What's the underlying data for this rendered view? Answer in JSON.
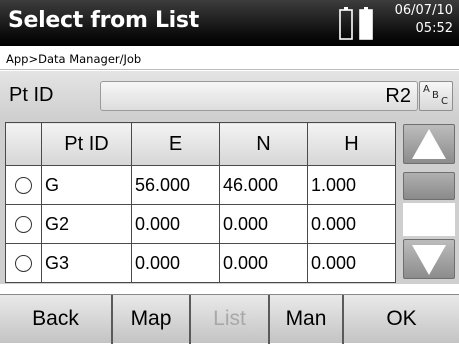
{
  "header": {
    "title": "Select from List",
    "date": "06/07/10",
    "time": "05:52"
  },
  "breadcrumb": "App>Data Manager/Job",
  "point_id": {
    "label": "Pt ID",
    "value": "R2",
    "input_mode_button": {
      "a": "A",
      "b": "B",
      "c": "C"
    }
  },
  "table": {
    "columns": [
      "Pt ID",
      "E",
      "N",
      "H"
    ],
    "rows": [
      {
        "id": "G",
        "e": "56.000",
        "n": "46.000",
        "h": "1.000"
      },
      {
        "id": "G2",
        "e": "0.000",
        "n": "0.000",
        "h": "0.000"
      },
      {
        "id": "G3",
        "e": "0.000",
        "n": "0.000",
        "h": "0.000"
      }
    ]
  },
  "softkeys": {
    "back": "Back",
    "map": "Map",
    "list": "List",
    "man": "Man",
    "ok": "OK"
  },
  "icons": {
    "battery": "battery-icon",
    "scroll_up": "triangle-up-icon",
    "scroll_down": "triangle-down-icon"
  }
}
